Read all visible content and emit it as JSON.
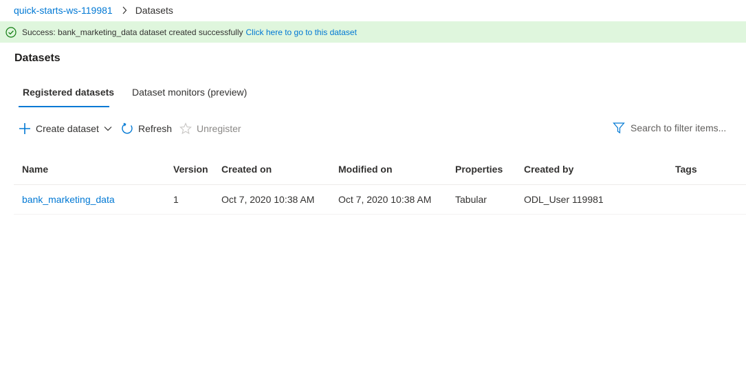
{
  "breadcrumb": {
    "workspace": "quick-starts-ws-119981",
    "current": "Datasets"
  },
  "banner": {
    "message": "Success: bank_marketing_data dataset created successfully",
    "link": "Click here to go to this dataset"
  },
  "page_title": "Datasets",
  "tabs": [
    {
      "label": "Registered datasets",
      "active": true
    },
    {
      "label": "Dataset monitors (preview)",
      "active": false
    }
  ],
  "toolbar": {
    "create_label": "Create dataset",
    "refresh_label": "Refresh",
    "unregister_label": "Unregister"
  },
  "search": {
    "placeholder": "Search to filter items..."
  },
  "table": {
    "columns": [
      "Name",
      "Version",
      "Created on",
      "Modified on",
      "Properties",
      "Created by",
      "Tags"
    ],
    "rows": [
      {
        "name": "bank_marketing_data",
        "version": "1",
        "created_on": "Oct 7, 2020 10:38 AM",
        "modified_on": "Oct 7, 2020 10:38 AM",
        "properties": "Tabular",
        "created_by": "ODL_User 119981",
        "tags": ""
      }
    ]
  },
  "colors": {
    "accent": "#0078d4",
    "success_bg": "#dff6dd",
    "success_icon": "#107c10",
    "text": "#323130",
    "disabled": "#8a8886"
  }
}
